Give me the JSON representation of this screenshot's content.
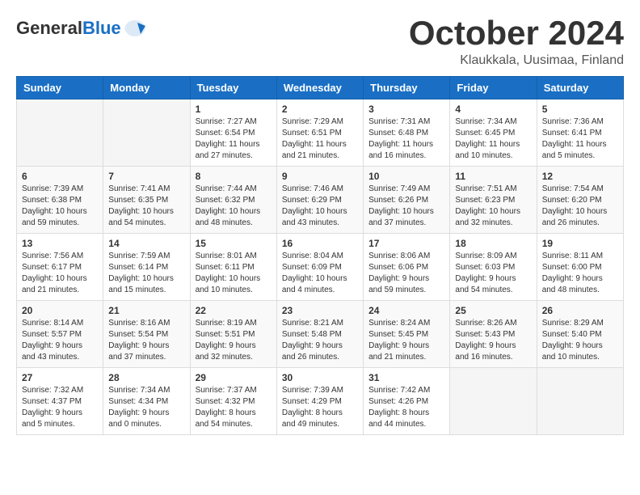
{
  "header": {
    "logo_general": "General",
    "logo_blue": "Blue",
    "month_title": "October 2024",
    "location": "Klaukkala, Uusimaa, Finland"
  },
  "days_of_week": [
    "Sunday",
    "Monday",
    "Tuesday",
    "Wednesday",
    "Thursday",
    "Friday",
    "Saturday"
  ],
  "weeks": [
    [
      {
        "day": "",
        "info": ""
      },
      {
        "day": "",
        "info": ""
      },
      {
        "day": "1",
        "info": "Sunrise: 7:27 AM\nSunset: 6:54 PM\nDaylight: 11 hours and 27 minutes."
      },
      {
        "day": "2",
        "info": "Sunrise: 7:29 AM\nSunset: 6:51 PM\nDaylight: 11 hours and 21 minutes."
      },
      {
        "day": "3",
        "info": "Sunrise: 7:31 AM\nSunset: 6:48 PM\nDaylight: 11 hours and 16 minutes."
      },
      {
        "day": "4",
        "info": "Sunrise: 7:34 AM\nSunset: 6:45 PM\nDaylight: 11 hours and 10 minutes."
      },
      {
        "day": "5",
        "info": "Sunrise: 7:36 AM\nSunset: 6:41 PM\nDaylight: 11 hours and 5 minutes."
      }
    ],
    [
      {
        "day": "6",
        "info": "Sunrise: 7:39 AM\nSunset: 6:38 PM\nDaylight: 10 hours and 59 minutes."
      },
      {
        "day": "7",
        "info": "Sunrise: 7:41 AM\nSunset: 6:35 PM\nDaylight: 10 hours and 54 minutes."
      },
      {
        "day": "8",
        "info": "Sunrise: 7:44 AM\nSunset: 6:32 PM\nDaylight: 10 hours and 48 minutes."
      },
      {
        "day": "9",
        "info": "Sunrise: 7:46 AM\nSunset: 6:29 PM\nDaylight: 10 hours and 43 minutes."
      },
      {
        "day": "10",
        "info": "Sunrise: 7:49 AM\nSunset: 6:26 PM\nDaylight: 10 hours and 37 minutes."
      },
      {
        "day": "11",
        "info": "Sunrise: 7:51 AM\nSunset: 6:23 PM\nDaylight: 10 hours and 32 minutes."
      },
      {
        "day": "12",
        "info": "Sunrise: 7:54 AM\nSunset: 6:20 PM\nDaylight: 10 hours and 26 minutes."
      }
    ],
    [
      {
        "day": "13",
        "info": "Sunrise: 7:56 AM\nSunset: 6:17 PM\nDaylight: 10 hours and 21 minutes."
      },
      {
        "day": "14",
        "info": "Sunrise: 7:59 AM\nSunset: 6:14 PM\nDaylight: 10 hours and 15 minutes."
      },
      {
        "day": "15",
        "info": "Sunrise: 8:01 AM\nSunset: 6:11 PM\nDaylight: 10 hours and 10 minutes."
      },
      {
        "day": "16",
        "info": "Sunrise: 8:04 AM\nSunset: 6:09 PM\nDaylight: 10 hours and 4 minutes."
      },
      {
        "day": "17",
        "info": "Sunrise: 8:06 AM\nSunset: 6:06 PM\nDaylight: 9 hours and 59 minutes."
      },
      {
        "day": "18",
        "info": "Sunrise: 8:09 AM\nSunset: 6:03 PM\nDaylight: 9 hours and 54 minutes."
      },
      {
        "day": "19",
        "info": "Sunrise: 8:11 AM\nSunset: 6:00 PM\nDaylight: 9 hours and 48 minutes."
      }
    ],
    [
      {
        "day": "20",
        "info": "Sunrise: 8:14 AM\nSunset: 5:57 PM\nDaylight: 9 hours and 43 minutes."
      },
      {
        "day": "21",
        "info": "Sunrise: 8:16 AM\nSunset: 5:54 PM\nDaylight: 9 hours and 37 minutes."
      },
      {
        "day": "22",
        "info": "Sunrise: 8:19 AM\nSunset: 5:51 PM\nDaylight: 9 hours and 32 minutes."
      },
      {
        "day": "23",
        "info": "Sunrise: 8:21 AM\nSunset: 5:48 PM\nDaylight: 9 hours and 26 minutes."
      },
      {
        "day": "24",
        "info": "Sunrise: 8:24 AM\nSunset: 5:45 PM\nDaylight: 9 hours and 21 minutes."
      },
      {
        "day": "25",
        "info": "Sunrise: 8:26 AM\nSunset: 5:43 PM\nDaylight: 9 hours and 16 minutes."
      },
      {
        "day": "26",
        "info": "Sunrise: 8:29 AM\nSunset: 5:40 PM\nDaylight: 9 hours and 10 minutes."
      }
    ],
    [
      {
        "day": "27",
        "info": "Sunrise: 7:32 AM\nSunset: 4:37 PM\nDaylight: 9 hours and 5 minutes."
      },
      {
        "day": "28",
        "info": "Sunrise: 7:34 AM\nSunset: 4:34 PM\nDaylight: 9 hours and 0 minutes."
      },
      {
        "day": "29",
        "info": "Sunrise: 7:37 AM\nSunset: 4:32 PM\nDaylight: 8 hours and 54 minutes."
      },
      {
        "day": "30",
        "info": "Sunrise: 7:39 AM\nSunset: 4:29 PM\nDaylight: 8 hours and 49 minutes."
      },
      {
        "day": "31",
        "info": "Sunrise: 7:42 AM\nSunset: 4:26 PM\nDaylight: 8 hours and 44 minutes."
      },
      {
        "day": "",
        "info": ""
      },
      {
        "day": "",
        "info": ""
      }
    ]
  ]
}
